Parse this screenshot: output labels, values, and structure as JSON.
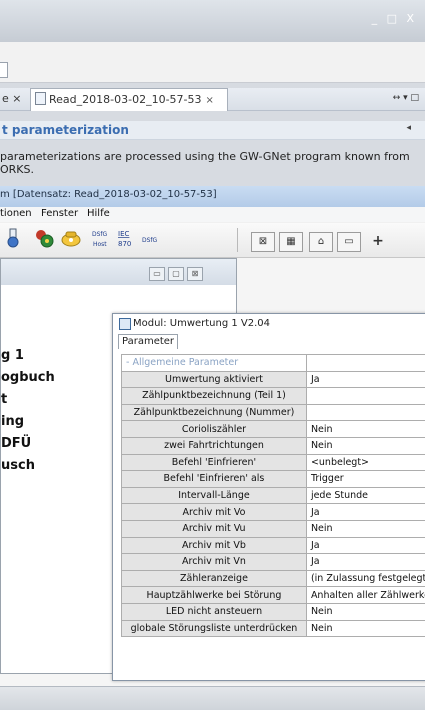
{
  "back_window": {
    "window_controls": "_ □ X",
    "tabs": [
      {
        "label": "e ×"
      },
      {
        "label": "Read_2018-03-02_10-57-53",
        "close": "×"
      }
    ],
    "tab_nav": "↔ ▾ □",
    "section_title": "t parameterization",
    "section_arrow": "◂",
    "info_line1": " parameterizations are processed using the GW-GNet program known from",
    "info_line2": "ORKS."
  },
  "app": {
    "title": "m [Datensatz: Read_2018-03-02_10-57-53]",
    "menu": [
      "tionen",
      "Fenster",
      "Hilfe"
    ],
    "toolbar_right": [
      "⊠",
      "▦",
      "⌂",
      "▭",
      "+"
    ]
  },
  "subwindow": {
    "controls": [
      "▭",
      "▢",
      "⊠"
    ],
    "items": [
      "g 1",
      "ogbuch",
      "t",
      "ing",
      "DFÜ",
      "usch"
    ]
  },
  "dialog": {
    "title": "Modul: Umwertung 1 V2.04",
    "tab_label": "Parameter",
    "category": "- Allgemeine Parameter",
    "rows": [
      {
        "name": "Umwertung aktiviert",
        "value": "Ja"
      },
      {
        "name": "Zählpunktbezeichnung (Teil 1)",
        "value": ""
      },
      {
        "name": "Zählpunktbezeichnung (Nummer)",
        "value": ""
      },
      {
        "name": "Corioliszähler",
        "value": "Nein"
      },
      {
        "name": "zwei Fahrtrichtungen",
        "value": "Nein"
      },
      {
        "name": "Befehl 'Einfrieren'",
        "value": "<unbelegt>"
      },
      {
        "name": "Befehl 'Einfrieren' als",
        "value": "Trigger"
      },
      {
        "name": "Intervall-Länge",
        "value": "jede Stunde"
      },
      {
        "name": "Archiv mit Vo",
        "value": "Ja"
      },
      {
        "name": "Archiv mit Vu",
        "value": "Nein"
      },
      {
        "name": "Archiv mit Vb",
        "value": "Ja"
      },
      {
        "name": "Archiv mit Vn",
        "value": "Ja"
      },
      {
        "name": "Zähleranzeige",
        "value": "(in Zulassung festgelegt)"
      },
      {
        "name": "Hauptzählwerke bei Störung",
        "value": "Anhalten aller Zählwerke"
      },
      {
        "name": "LED nicht ansteuern",
        "value": "Nein"
      },
      {
        "name": "globale Störungsliste unterdrücken",
        "value": "Nein"
      }
    ]
  }
}
